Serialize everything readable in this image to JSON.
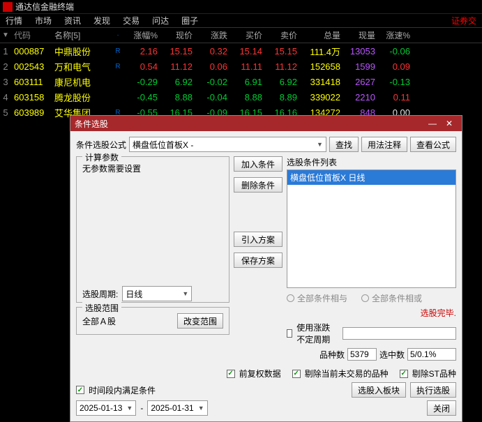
{
  "app_title": "通达信金融终端",
  "menubar": [
    "行情",
    "市场",
    "资讯",
    "发现",
    "交易",
    "问达",
    "圈子"
  ],
  "menu_right": "证券交",
  "columns": {
    "idx": "",
    "code": "代码",
    "name": "名称[5]",
    "sort": "·",
    "pct": "涨幅%",
    "price": "现价",
    "chg": "涨跌",
    "bid": "买价",
    "ask": "卖价",
    "vol": "总量",
    "now": "现量",
    "spd": "涨速%"
  },
  "rows": [
    {
      "idx": "1",
      "code": "000887",
      "name": "中鼎股份",
      "r": "R",
      "pct": "2.16",
      "price": "15.15",
      "chg": "0.32",
      "bid": "15.14",
      "ask": "15.15",
      "vol": "111.4万",
      "now": "13053",
      "spd": "-0.06",
      "dir": "up"
    },
    {
      "idx": "2",
      "code": "002543",
      "name": "万和电气",
      "r": "R",
      "pct": "0.54",
      "price": "11.12",
      "chg": "0.06",
      "bid": "11.11",
      "ask": "11.12",
      "vol": "152658",
      "now": "1599",
      "spd": "0.09",
      "dir": "up"
    },
    {
      "idx": "3",
      "code": "603111",
      "name": "康尼机电",
      "r": "",
      "pct": "-0.29",
      "price": "6.92",
      "chg": "-0.02",
      "bid": "6.91",
      "ask": "6.92",
      "vol": "331418",
      "now": "2627",
      "spd": "-0.13",
      "dir": "down"
    },
    {
      "idx": "4",
      "code": "603158",
      "name": "腾龙股份",
      "r": "",
      "pct": "-0.45",
      "price": "8.88",
      "chg": "-0.04",
      "bid": "8.88",
      "ask": "8.89",
      "vol": "339022",
      "now": "2210",
      "spd": "0.11",
      "dir": "down"
    },
    {
      "idx": "5",
      "code": "603989",
      "name": "艾华集团",
      "r": "R",
      "pct": "-0.55",
      "price": "16.15",
      "chg": "-0.09",
      "bid": "16.15",
      "ask": "16.16",
      "vol": "134272",
      "now": "848",
      "spd": "0.00",
      "dir": "down"
    }
  ],
  "dialog": {
    "title": "条件选股",
    "formula_label": "条件选股公式",
    "formula_value": "横盘低位首板X -",
    "btn_find": "查找",
    "btn_usage": "用法注释",
    "btn_view": "查看公式",
    "params_legend": "计算参数",
    "params_text": "无参数需要设置",
    "period_label": "选股周期:",
    "period_value": "日线",
    "scope_legend": "选股范围",
    "scope_value": "全部Ａ股",
    "btn_change_scope": "改变范围",
    "btn_add": "加入条件",
    "btn_del": "删除条件",
    "btn_import": "引入方案",
    "btn_save": "保存方案",
    "list_legend": "选股条件列表",
    "list_item": "横盘低位首板X  日线",
    "radio_and": "全部条件相与",
    "radio_or": "全部条件相或",
    "status": "选股完毕.",
    "chk_irregular": "使用涨跌不定周期",
    "count_label": "品种数",
    "count_value": "5379",
    "sel_label": "选中数",
    "sel_value": "5/0.1%",
    "chk_fq": "前复权数据",
    "chk_exclude_nontrade": "剔除当前未交易的品种",
    "chk_exclude_st": "剔除ST品种",
    "chk_time": "时间段内满足条件",
    "btn_toblock": "选股入板块",
    "btn_run": "执行选股",
    "btn_close": "关闭",
    "date_from": "2025-01-13",
    "date_to": "2025-01-31",
    "date_sep": "-"
  }
}
